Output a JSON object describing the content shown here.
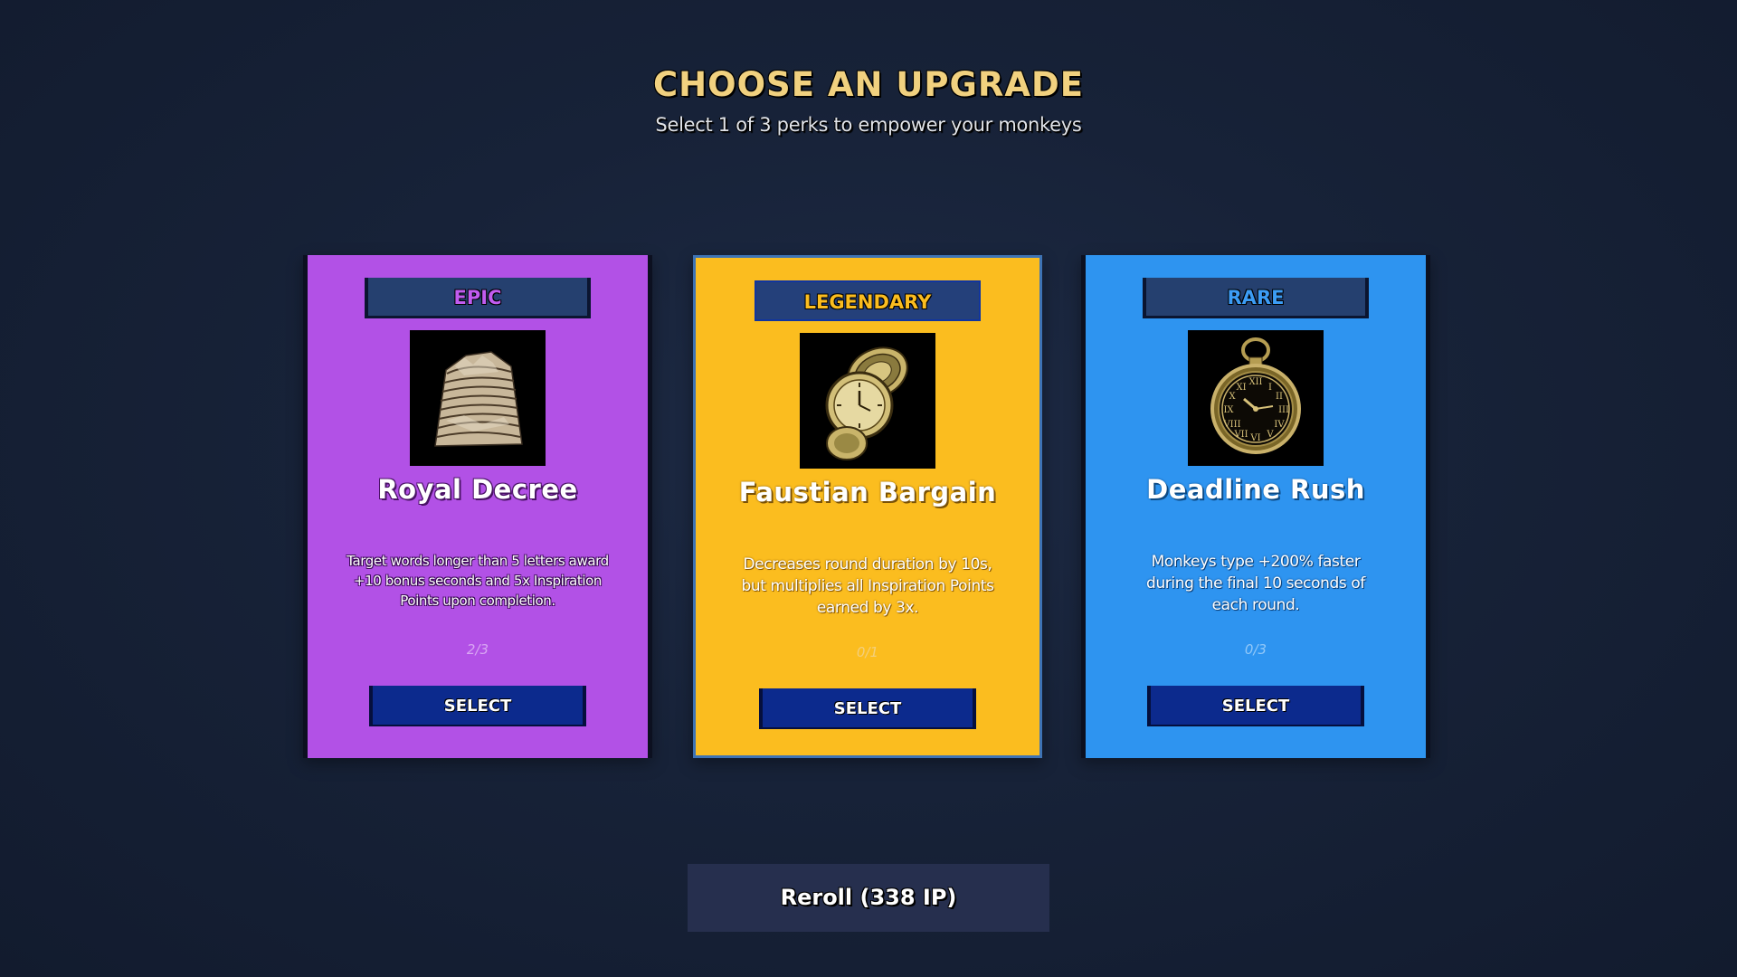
{
  "header": {
    "title": "CHOOSE AN UPGRADE",
    "subtitle": "Select 1 of 3 perks to empower your monkeys"
  },
  "cards": [
    {
      "rarity": "EPIC",
      "name": "Royal Decree",
      "description": "Target words longer than 5 letters award +10 bonus seconds and 5x Inspiration Points upon completion.",
      "progress": "2/3",
      "select_label": "SELECT",
      "art_icon": "paper-stack-icon",
      "color": "#b251e6"
    },
    {
      "rarity": "LEGENDARY",
      "name": "Faustian Bargain",
      "description": "Decreases round duration by 10s, but multiplies all Inspiration Points earned by 3x.",
      "progress": "0/1",
      "select_label": "SELECT",
      "art_icon": "open-pocket-watch-icon",
      "color": "#fbbd1f"
    },
    {
      "rarity": "RARE",
      "name": "Deadline Rush",
      "description": "Monkeys type +200% faster during the final 10 seconds of each round.",
      "progress": "0/3",
      "select_label": "SELECT",
      "art_icon": "pocket-watch-icon",
      "color": "#2e94f0"
    }
  ],
  "reroll": {
    "label": "Reroll (338 IP)"
  }
}
